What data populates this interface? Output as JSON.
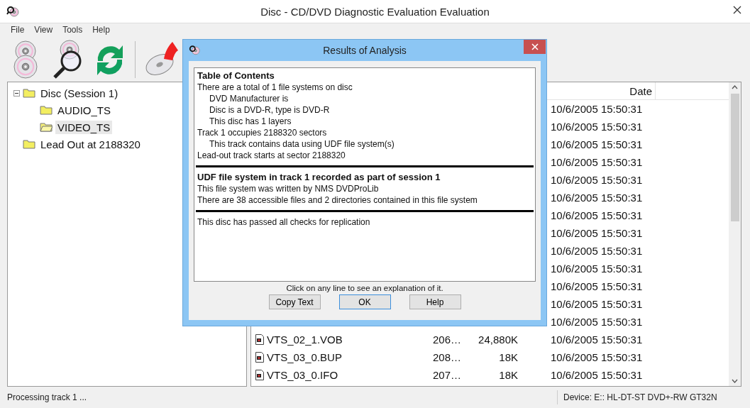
{
  "window": {
    "title": "Disc - CD/DVD Diagnostic Evaluation Evaluation"
  },
  "menu": [
    "File",
    "View",
    "Tools",
    "Help"
  ],
  "tree": [
    {
      "label": "Disc (Session 1)",
      "expanded": true,
      "selected": false,
      "children": [
        {
          "label": "AUDIO_TS",
          "selected": false
        },
        {
          "label": "VIDEO_TS",
          "selected": true
        }
      ]
    },
    {
      "label": "Lead Out at 2188320",
      "selected": false
    }
  ],
  "list": {
    "columns": [
      {
        "label": "Date"
      }
    ],
    "rows": [
      {
        "date": "10/6/2005 15:50:31"
      },
      {
        "date": "10/6/2005 15:50:31"
      },
      {
        "date": "10/6/2005 15:50:31"
      },
      {
        "date": "10/6/2005 15:50:31"
      },
      {
        "date": "10/6/2005 15:50:31"
      },
      {
        "date": "10/6/2005 15:50:31"
      },
      {
        "date": "10/6/2005 15:50:31"
      },
      {
        "date": "10/6/2005 15:50:31"
      },
      {
        "date": "10/6/2005 15:50:31"
      },
      {
        "date": "10/6/2005 15:50:31"
      },
      {
        "date": "10/6/2005 15:50:31"
      },
      {
        "date": "10/6/2005 15:50:31"
      },
      {
        "date": "10/6/2005 15:50:31"
      },
      {
        "name": "VTS_02_1.VOB",
        "column_2": "206…",
        "size": "24,880K",
        "date": "10/6/2005 15:50:31"
      },
      {
        "name": "VTS_03_0.BUP",
        "column_2": "208…",
        "size": "18K",
        "date": "10/6/2005 15:50:31"
      },
      {
        "name": "VTS_03_0.IFO",
        "column_2": "207…",
        "size": "18K",
        "date": "10/6/2005 15:50:31"
      }
    ]
  },
  "dialog": {
    "title": "Results of Analysis",
    "sections": [
      [
        {
          "kind": "heading",
          "text": "Table of Contents"
        },
        {
          "kind": "text",
          "text": "There are a total of 1 file systems on disc"
        },
        {
          "kind": "indent",
          "text": "DVD Manufacturer is"
        },
        {
          "kind": "indent",
          "text": "Disc is a DVD-R, type is DVD-R"
        },
        {
          "kind": "indent",
          "text": "This disc has 1 layers"
        },
        {
          "kind": "text",
          "text": "Track 1 occupies 2188320 sectors"
        },
        {
          "kind": "indent",
          "text": "This track contains data using UDF file system(s)"
        },
        {
          "kind": "text",
          "text": "Lead-out track starts at sector 2188320"
        }
      ],
      [
        {
          "kind": "heading",
          "text": "UDF file system in track 1 recorded as part of session 1"
        },
        {
          "kind": "text",
          "text": "This file system was written by NMS DVDProLib"
        },
        {
          "kind": "text",
          "text": "There are 38 accessible files and 2 directories contained in this file system"
        }
      ],
      [
        {
          "kind": "text",
          "text": "This disc has passed all checks for replication"
        }
      ]
    ],
    "hint": "Click on any line to see an explanation of it.",
    "buttons": [
      {
        "label": "Copy Text",
        "default": false
      },
      {
        "label": "OK",
        "default": true
      },
      {
        "label": "Help",
        "default": false
      }
    ]
  },
  "status_bar": {
    "message": "Processing track 1 ...",
    "device": "Device: E:: HL-DT-ST DVD+-RW GT32N"
  }
}
